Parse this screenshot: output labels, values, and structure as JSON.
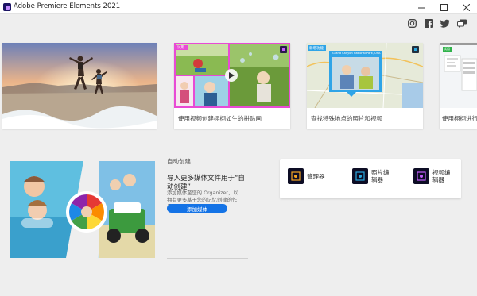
{
  "window": {
    "title": "Adobe Premiere Elements 2021",
    "controls": [
      "minimize",
      "maximize",
      "close"
    ]
  },
  "social": [
    "instagram-icon",
    "facebook-icon",
    "twitter-icon",
    "feedback-icon"
  ],
  "carousel": {
    "cards": [
      {
        "caption": ""
      },
      {
        "caption": "使用视频创建栩栩如生的拼贴画",
        "badge": "试用"
      },
      {
        "caption": "查找特殊地点的照片和视频",
        "badge": "新增功能",
        "map_label": "Grand Canyon National Park, USA"
      },
      {
        "caption": "使用栩栩进行",
        "badge": "试用"
      }
    ]
  },
  "auto_create": {
    "section_label": "自动创建",
    "headline": "导入更多媒体文件用于“自动创建”",
    "description": "添加媒体至您的 Organizer，以拥有更多基于您的记忆创建的作品。",
    "button_label": "添加媒体"
  },
  "launcher": {
    "apps": [
      {
        "label": "管理器",
        "icon": "organizer-icon",
        "color": "#f5a623"
      },
      {
        "label": "照片编辑器",
        "icon": "photo-editor-icon",
        "color": "#29a9e0"
      },
      {
        "label": "视频编辑器",
        "icon": "video-editor-icon",
        "color": "#c45eff"
      }
    ]
  }
}
